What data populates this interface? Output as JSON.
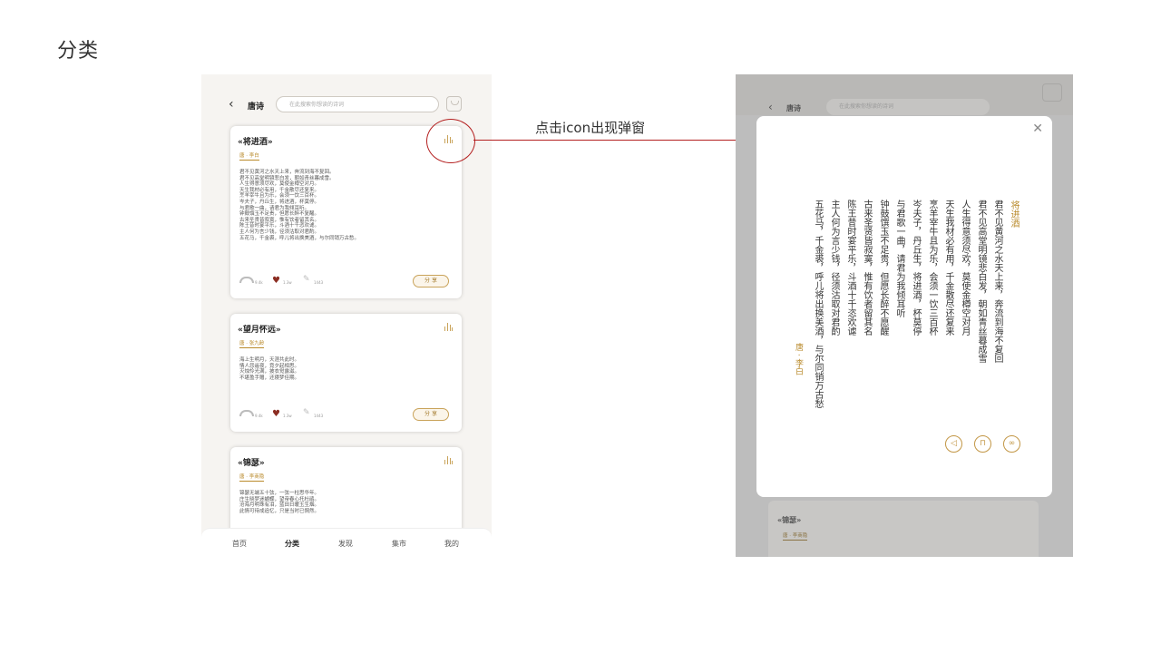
{
  "slide": {
    "title": "分类"
  },
  "phone": {
    "header": {
      "title": "唐诗",
      "search_placeholder": "在此搜索你想读的诗词"
    },
    "cards": [
      {
        "title": "«将进酒»",
        "author": "唐 · 李白",
        "lines": [
          "君不见黄河之水天上来，奔流到海不复回。",
          "君不见高堂明镜悲白发，朝如青丝暮成雪。",
          "人生得意须尽欢，莫使金樽空对月。",
          "天生我材必有用，千金散尽还复来。",
          "烹羊宰牛且为乐，会须一饮三百杯。",
          "岑夫子，丹丘生，将进酒，杯莫停。",
          "与君歌一曲，请君为我倾耳听。",
          "钟鼓馔玉不足贵，但愿长醉不复醒。",
          "古来圣贤皆寂寞，惟有饮者留其名。",
          "陈王昔时宴平乐，斗酒十千恣欢谑。",
          "主人何为言少钱，径须沽取对君酌。",
          "五花马，千金裘，呼儿将出换美酒，与尔同销万古愁。"
        ],
        "stats": {
          "views": "9.4k",
          "likes": "1.3w",
          "comments": "1443"
        },
        "share_label": "分 享"
      },
      {
        "title": "«望月怀远»",
        "author": "唐 · 张九龄",
        "lines": [
          "海上生明月，天涯共此时。",
          "情人怨遥夜，竟夕起相思。",
          "灭烛怜光满，披衣觉露滋。",
          "不堪盈手赠，还寝梦佳期。"
        ],
        "stats": {
          "views": "9.4k",
          "likes": "1.3w",
          "comments": "1443"
        },
        "share_label": "分 享"
      },
      {
        "title": "«锦瑟»",
        "author": "唐 · 李商隐",
        "lines": [
          "锦瑟无端五十弦，一弦一柱思华年。",
          "庄生晓梦迷蝴蝶，望帝春心托杜鹃。",
          "沧海月明珠有泪，蓝田日暖玉生烟。",
          "此情可待成追忆，只是当时已惘然。"
        ]
      }
    ],
    "nav": [
      "首页",
      "分类",
      "发现",
      "集市",
      "我的"
    ]
  },
  "annotation": {
    "text": "点击icon出现弹窗"
  },
  "overlay": {
    "header": {
      "title": "唐诗",
      "search_placeholder": "在此搜索你想读的诗词"
    },
    "behind_card": {
      "title": "«锦瑟»",
      "author": "唐 · 李商隐"
    },
    "modal": {
      "title": "将进酒",
      "author": "唐 · 李白",
      "lines": [
        "君不见黄河之水天上来，奔流到海不复回",
        "君不见高堂明镜悲白发，朝如青丝暮成雪",
        "人生得意须尽欢，莫使金樽空对月",
        "天生我材必有用，千金散尽还复来",
        "烹羊宰牛且为乐，会须一饮三百杯",
        "岑夫子，丹丘生，将进酒，杯莫停",
        "与君歌一曲，请君为我倾耳听",
        "钟鼓馔玉不足贵，但愿长醉不愿醒",
        "古来圣贤皆寂寞，惟有饮者留其名",
        "陈王昔时宴平乐，斗酒十千恣欢谑",
        "主人何为言少钱，径须沽取对君酌",
        "五花马，千金裘，呼儿将出换美酒，与尔同销万古愁"
      ],
      "actions": [
        "volume-icon",
        "bookmark-icon",
        "share-icon"
      ]
    }
  },
  "colors": {
    "accent": "#b98a2b",
    "heart": "#8b2d22",
    "annotation": "#b42020"
  }
}
